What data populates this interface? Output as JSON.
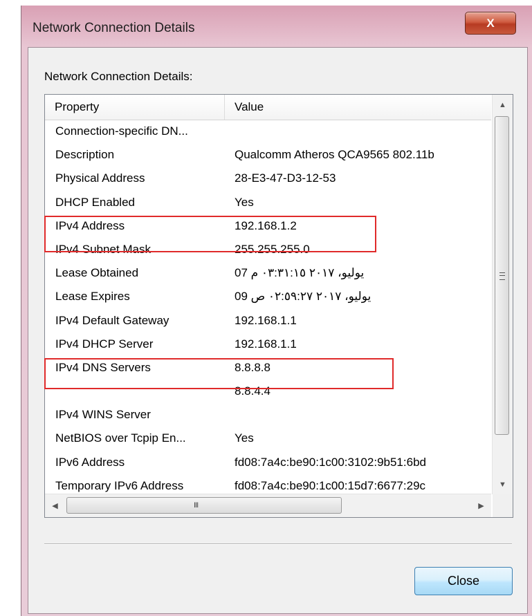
{
  "window": {
    "title": "Network Connection Details",
    "close_glyph": "X",
    "frame_color": "#e8c6d3",
    "close_color": "#c7472b"
  },
  "group_label": "Network Connection Details:",
  "table": {
    "columns": [
      "Property",
      "Value"
    ],
    "rows": [
      {
        "property": "Connection-specific DN...",
        "value": ""
      },
      {
        "property": "Description",
        "value": "Qualcomm Atheros QCA9565 802.11b"
      },
      {
        "property": "Physical Address",
        "value": "28-E3-47-D3-12-53"
      },
      {
        "property": "DHCP Enabled",
        "value": "Yes"
      },
      {
        "property": "IPv4 Address",
        "value": "192.168.1.2"
      },
      {
        "property": "IPv4 Subnet Mask",
        "value": "255.255.255.0"
      },
      {
        "property": "Lease Obtained",
        "value": "يوليو، ٢٠١٧ ٠٣:٣١:١٥ م 07"
      },
      {
        "property": "Lease Expires",
        "value": "يوليو، ٢٠١٧ ٠٢:٥٩:٢٧ ص 09"
      },
      {
        "property": "IPv4 Default Gateway",
        "value": "192.168.1.1"
      },
      {
        "property": "IPv4 DHCP Server",
        "value": "192.168.1.1"
      },
      {
        "property": "IPv4 DNS Servers",
        "value": "8.8.8.8"
      },
      {
        "property": "",
        "value": "8.8.4.4"
      },
      {
        "property": "IPv4 WINS Server",
        "value": ""
      },
      {
        "property": "NetBIOS over Tcpip En...",
        "value": "Yes"
      },
      {
        "property": "IPv6 Address",
        "value": "fd08:7a4c:be90:1c00:3102:9b51:6bd"
      },
      {
        "property": "Temporary IPv6 Address",
        "value": "fd08:7a4c:be90:1c00:15d7:6677:29c"
      }
    ]
  },
  "highlight_color": "#e02a2a",
  "icons": {
    "scroll_up": "scroll-up-arrow-icon",
    "scroll_down": "scroll-down-arrow-icon",
    "scroll_left": "scroll-left-arrow-icon",
    "scroll_right": "scroll-right-arrow-icon",
    "grip": "III"
  },
  "close_button": "Close"
}
